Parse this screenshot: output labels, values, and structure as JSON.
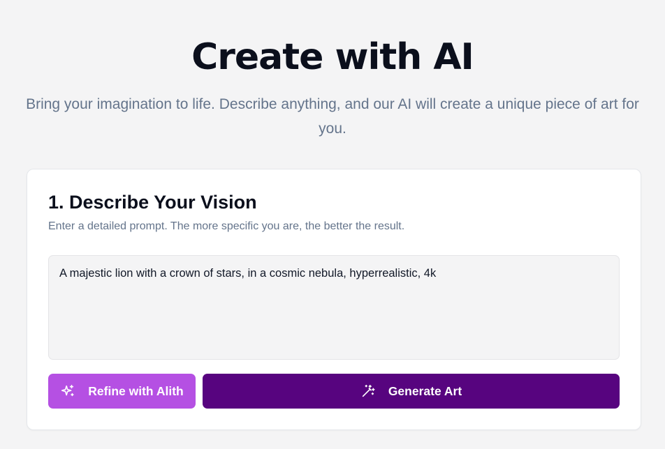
{
  "hero": {
    "title": "Create with AI",
    "subtitle": "Bring your imagination to life. Describe anything, and our AI will create a unique piece of art for you."
  },
  "step": {
    "title": "1. Describe Your Vision",
    "description": "Enter a detailed prompt. The more specific you are, the better the result.",
    "prompt_value": "A majestic lion with a crown of stars, in a cosmic nebula, hyperrealistic, 4k"
  },
  "actions": {
    "refine_label": "Refine with Alith",
    "refine_icon": "sparkles-icon",
    "generate_label": "Generate Art",
    "generate_icon": "magic-wand-icon"
  },
  "colors": {
    "refine_button": "#b550e3",
    "generate_button": "#57047f",
    "page_background": "#f4f4f5",
    "title_text": "#0b0f1c",
    "muted_text": "#64748b"
  }
}
